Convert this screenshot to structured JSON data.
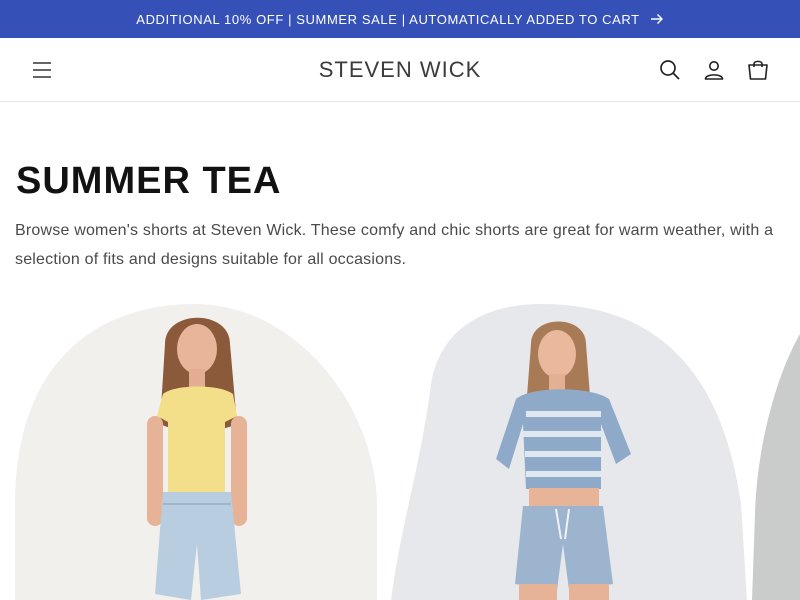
{
  "announcement": {
    "text": "ADDITIONAL 10% OFF | SUMMER SALE | AUTOMATICALLY ADDED TO CART",
    "icon": "arrow-right-icon",
    "background": "#3551b7"
  },
  "header": {
    "brand": "STEVEN WICK",
    "icons": [
      "menu-icon",
      "search-icon",
      "account-icon",
      "cart-icon"
    ]
  },
  "collection": {
    "title": "SUMMER TEA",
    "description": "Browse women's shorts at Steven Wick. These comfy and chic shorts are great for warm weather, with a selection of fits and designs suitable for all occasions."
  },
  "products": [
    {
      "image": "model-yellow-top-denim-shorts"
    },
    {
      "image": "model-tie-dye-crop-top-denim-shorts"
    },
    {
      "image": "product-image-partial"
    }
  ]
}
